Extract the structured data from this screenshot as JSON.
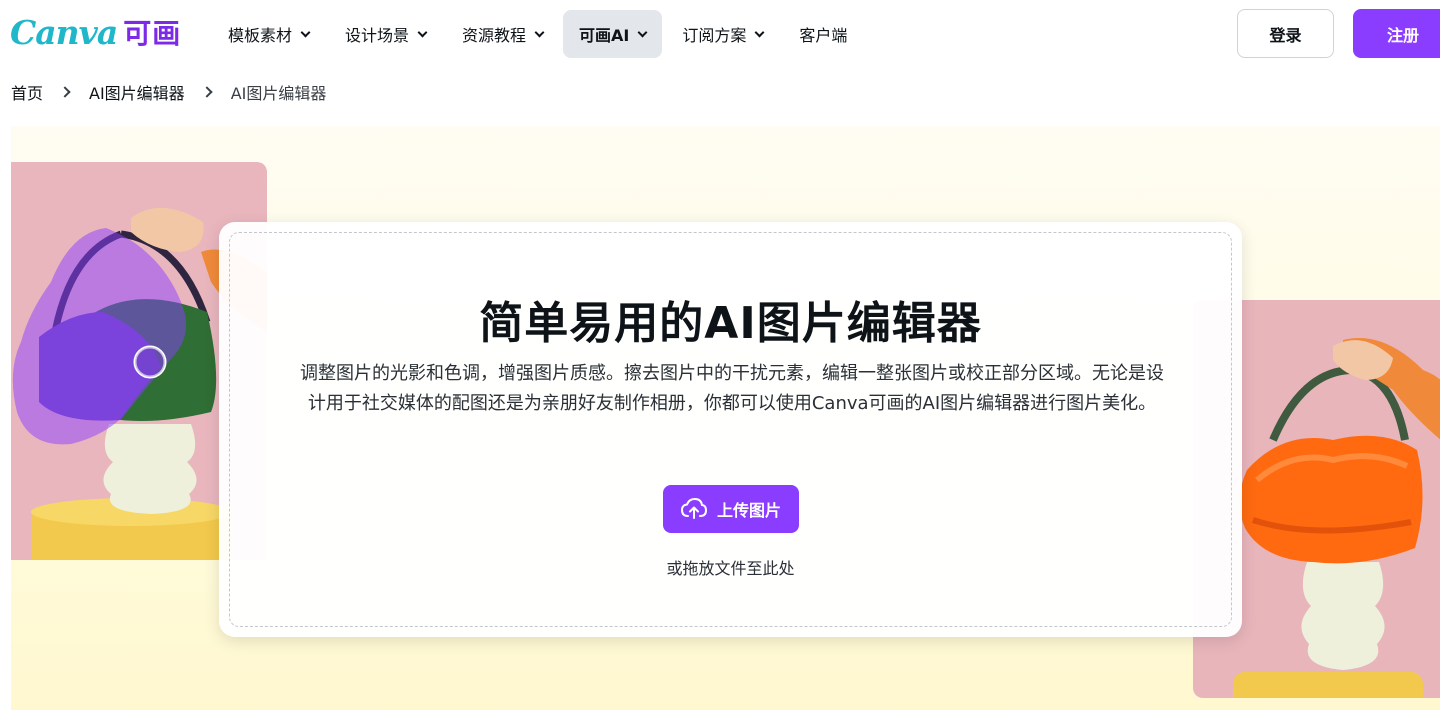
{
  "header": {
    "logo_latin": "Canva",
    "logo_cn": "可画",
    "nav": [
      {
        "label": "模板素材",
        "has_dropdown": true,
        "active": false
      },
      {
        "label": "设计场景",
        "has_dropdown": true,
        "active": false
      },
      {
        "label": "资源教程",
        "has_dropdown": true,
        "active": false
      },
      {
        "label": "可画AI",
        "has_dropdown": true,
        "active": true
      },
      {
        "label": "订阅方案",
        "has_dropdown": true,
        "active": false
      },
      {
        "label": "客户端",
        "has_dropdown": false,
        "active": false
      }
    ],
    "login_label": "登录",
    "register_label": "注册"
  },
  "breadcrumb": {
    "items": [
      "首页",
      "AI图片编辑器",
      "AI图片编辑器"
    ]
  },
  "hero": {
    "title": "简单易用的AI图片编辑器",
    "description": "调整图片的光影和色调，增强图片质感。擦去图片中的干扰元素，编辑一整张图片或校正部分区域。无论是设计用于社交媒体的配图还是为亲朋好友制作相册，你都可以使用Canva可画的AI图片编辑器进行图片美化。",
    "upload_label": "上传图片",
    "drop_hint": "或拖放文件至此处"
  },
  "colors": {
    "brand_purple": "#8b3dff",
    "logo_teal": "#1fb7c9",
    "active_nav_bg": "#e3e6eb",
    "hero_bg": "#fffbe0",
    "photo_pink": "#e9b6be"
  },
  "icons": [
    "chevron-down-icon",
    "chevron-right-icon",
    "cloud-upload-icon"
  ]
}
